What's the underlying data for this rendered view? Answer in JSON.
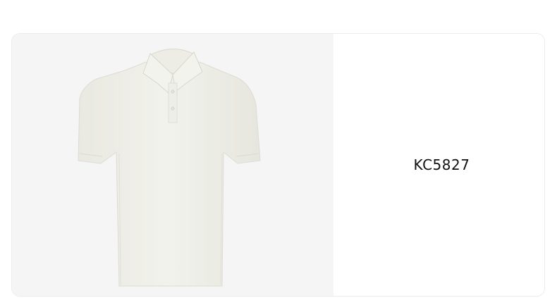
{
  "product": {
    "image_icon": "polo-shirt-image",
    "image_color": "#f0f0ea",
    "pane_background": "#f5f5f5",
    "sku": "KC5827"
  }
}
